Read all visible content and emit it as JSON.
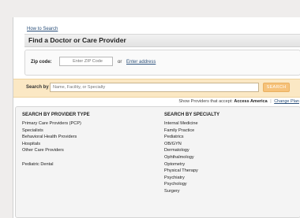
{
  "header": {
    "how_to_search": "How to Search",
    "title": "Find a Doctor or Care Provider"
  },
  "zip": {
    "label": "Zip code:",
    "placeholder": "Enter ZIP Code",
    "or_text": "or",
    "enter_address": "Enter address"
  },
  "search": {
    "label": "Search by",
    "placeholder": "Name, Facility, or Specialty",
    "button": "SEARCH"
  },
  "network": {
    "prefix": "Show Providers that accept:",
    "plan": "Access America",
    "separator": "|",
    "change_plan": "Change Plan"
  },
  "provider_type": {
    "heading": "SEARCH BY PROVIDER TYPE",
    "items": [
      "Primary Care Providers (PCP)",
      "Specialists",
      "Behavioral Health Providers",
      "Hospitals",
      "Other Care Providers"
    ],
    "extra": "Pediatric Dental"
  },
  "specialty": {
    "heading": "SEARCH BY SPECIALTY",
    "items": [
      "Internal Medicine",
      "Family Practice",
      "Pediatrics",
      "OB/GYN",
      "Dermatology",
      "Ophthalmology",
      "Optometry",
      "Physical Therapy",
      "Psychiatry",
      "Psychology",
      "Surgery"
    ]
  },
  "colors": {
    "page_bg": "#efedec",
    "link": "#2a4f7a",
    "search_band": "#fbe8c4",
    "search_button": "#f6c27a"
  }
}
